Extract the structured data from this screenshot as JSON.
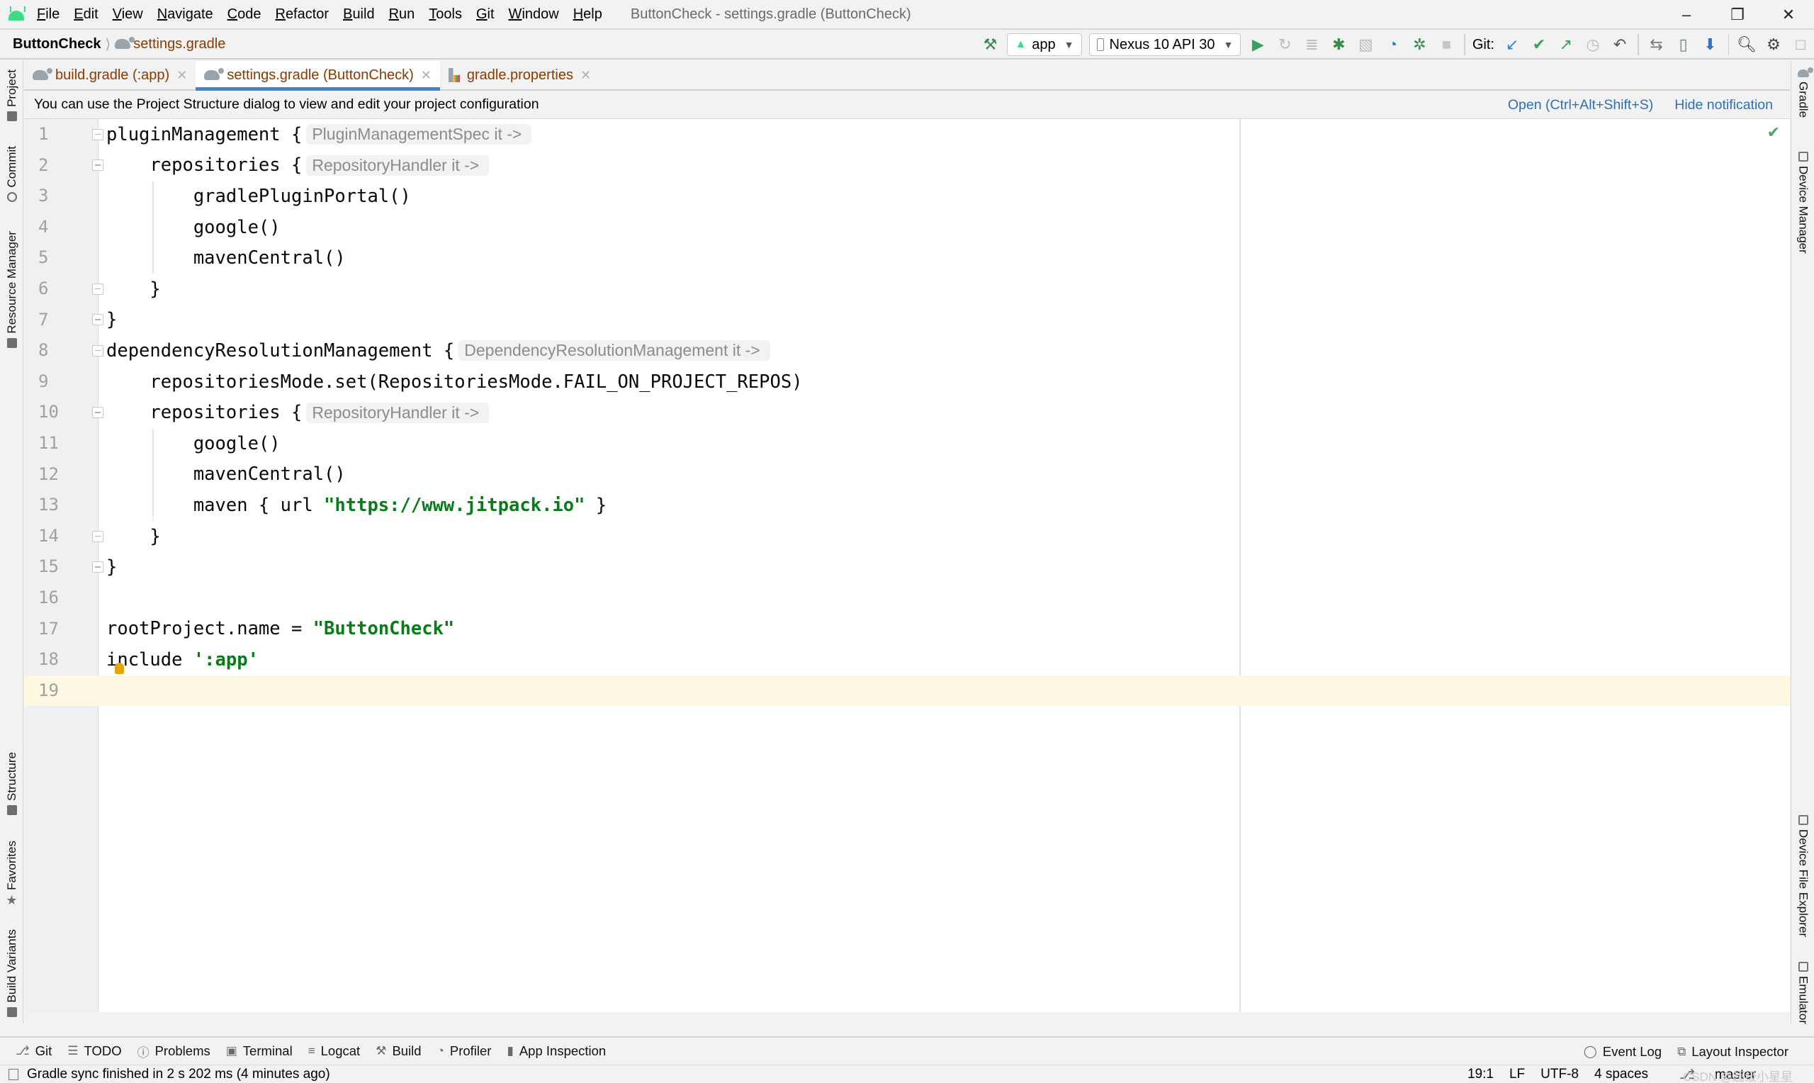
{
  "window": {
    "title": "ButtonCheck - settings.gradle (ButtonCheck)",
    "menu": [
      "File",
      "Edit",
      "View",
      "Navigate",
      "Code",
      "Refactor",
      "Build",
      "Run",
      "Tools",
      "Git",
      "Window",
      "Help"
    ],
    "controls": {
      "minimize": "–",
      "restore": "❐",
      "close": "✕"
    }
  },
  "breadcrumb": {
    "project": "ButtonCheck",
    "file": "settings.gradle"
  },
  "toolbar": {
    "run_config": "app",
    "device": "Nexus 10 API 30",
    "git_label": "Git:"
  },
  "tabs": [
    {
      "label": "build.gradle (:app)",
      "active": false
    },
    {
      "label": "settings.gradle (ButtonCheck)",
      "active": true
    },
    {
      "label": "gradle.properties",
      "active": false
    }
  ],
  "notification": {
    "message": "You can use the Project Structure dialog to view and edit your project configuration",
    "open_link": "Open (Ctrl+Alt+Shift+S)",
    "hide_link": "Hide notification"
  },
  "left_tools": [
    "Project",
    "Commit",
    "Resource Manager",
    "Structure",
    "Favorites",
    "Build Variants"
  ],
  "right_tools": [
    "Gradle",
    "Device Manager",
    "Device File Explorer",
    "Emulator"
  ],
  "editor": {
    "lines": [
      {
        "n": "1",
        "code": "pluginManagement {",
        "hint": "PluginManagementSpec it ->"
      },
      {
        "n": "2",
        "code": "    repositories {",
        "hint": "RepositoryHandler it ->"
      },
      {
        "n": "3",
        "code": "        gradlePluginPortal()"
      },
      {
        "n": "4",
        "code": "        google()"
      },
      {
        "n": "5",
        "code": "        mavenCentral()"
      },
      {
        "n": "6",
        "code": "    }"
      },
      {
        "n": "7",
        "code": "}"
      },
      {
        "n": "8",
        "code": "dependencyResolutionManagement {",
        "hint": "DependencyResolutionManagement it ->"
      },
      {
        "n": "9",
        "code": "    repositoriesMode.set(RepositoriesMode.FAIL_ON_PROJECT_REPOS)"
      },
      {
        "n": "10",
        "code": "    repositories {",
        "hint": "RepositoryHandler it ->"
      },
      {
        "n": "11",
        "code": "        google()"
      },
      {
        "n": "12",
        "code": "        mavenCentral()"
      },
      {
        "n": "13",
        "code_pre": "        maven { url ",
        "string": "\"https://www.jitpack.io\"",
        "code_post": " }"
      },
      {
        "n": "14",
        "code": "    }"
      },
      {
        "n": "15",
        "code": "}"
      },
      {
        "n": "16",
        "code": ""
      },
      {
        "n": "17",
        "code_pre": "rootProject.name = ",
        "string": "\"ButtonCheck\"",
        "code_post": ""
      },
      {
        "n": "18",
        "code_pre": "include ",
        "string": "':app'",
        "code_post": ""
      },
      {
        "n": "19",
        "code": ""
      }
    ],
    "current_line": 19
  },
  "bottom_tools": {
    "left": [
      {
        "icon": "git-branch-icon",
        "glyph": "⎇",
        "label": "Git"
      },
      {
        "icon": "todo-icon",
        "glyph": "☰",
        "label": "TODO"
      },
      {
        "icon": "problems-icon",
        "glyph": "ⓘ",
        "label": "Problems"
      },
      {
        "icon": "terminal-icon",
        "glyph": "▣",
        "label": "Terminal"
      },
      {
        "icon": "logcat-icon",
        "glyph": "≡",
        "label": "Logcat"
      },
      {
        "icon": "build-hammer-icon",
        "glyph": "⚒",
        "label": "Build"
      },
      {
        "icon": "profiler-icon",
        "glyph": "◔",
        "label": "Profiler"
      },
      {
        "icon": "app-inspection-icon",
        "glyph": "▮",
        "label": "App Inspection"
      }
    ],
    "right": [
      {
        "icon": "event-log-icon",
        "glyph": "◯",
        "label": "Event Log"
      },
      {
        "icon": "layout-inspector-icon",
        "glyph": "⧉",
        "label": "Layout Inspector"
      }
    ]
  },
  "status": {
    "message": "Gradle sync finished in 2 s 202 ms (4 minutes ago)",
    "position": "19:1",
    "line_sep": "LF",
    "encoding": "UTF-8",
    "indent": "4 spaces",
    "branch": "master",
    "watermark": "CSDN @超级小星星"
  }
}
